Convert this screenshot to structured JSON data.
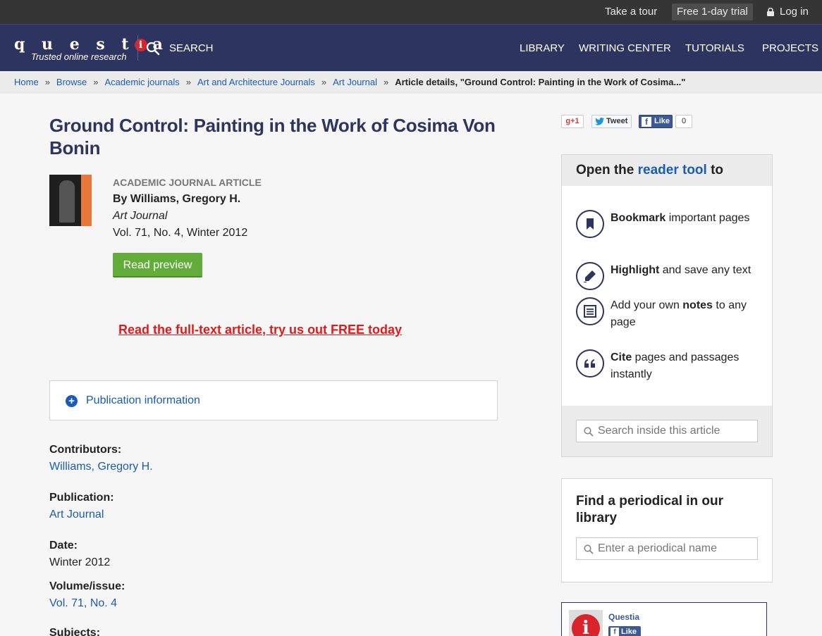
{
  "topbar": {
    "take_tour": "Take a tour",
    "free_trial": "Free 1-day trial",
    "login": "Log in"
  },
  "nav": {
    "logo_word": "questia",
    "logo_tagline": "Trusted online research",
    "search": "SEARCH",
    "links": [
      "LIBRARY",
      "WRITING CENTER",
      "TUTORIALS",
      "PROJECTS"
    ]
  },
  "breadcrumb": {
    "items": [
      "Home",
      "Browse",
      "Academic journals",
      "Art and Architecture Journals",
      "Art Journal"
    ],
    "separator": "»",
    "current": "Article details, \"Ground Control: Painting in the Work of Cosima...\""
  },
  "article": {
    "title": "Ground Control: Painting in the Work of Cosima Von Bonin",
    "type": "ACADEMIC JOURNAL ARTICLE",
    "author": "By Williams, Gregory H.",
    "journal": "Art Journal",
    "volume": "Vol. 71, No. 4, Winter 2012",
    "read_preview": "Read preview",
    "promo": "Read the full-text article, try us out FREE today",
    "pub_info_label": "Publication information",
    "plus": "+"
  },
  "details": [
    {
      "term": "Contributors:",
      "value": "Williams, Gregory H.",
      "link": true
    },
    {
      "term": "Publication:",
      "value": "Art Journal",
      "link": true
    },
    {
      "term": "Date:",
      "value": "Winter 2012",
      "link": false
    },
    {
      "term": "Volume/issue:",
      "value": "Vol. 71, No. 4",
      "link": true
    },
    {
      "term": "Subjects:",
      "value": "",
      "link": false
    }
  ],
  "social": {
    "gplus": "g+1",
    "tweet": "Tweet",
    "like": "Like",
    "like_count": "0"
  },
  "reader": {
    "head_prefix": "Open the",
    "head_highlight": "reader tool",
    "head_suffix": "to",
    "features": [
      {
        "icon": "bookmark-icon",
        "bold": "Bookmark",
        "before": "",
        "after": " important pages"
      },
      {
        "icon": "highlight-pen-icon",
        "bold": "Highlight",
        "before": "",
        "after": " and save any text"
      },
      {
        "icon": "notes-icon",
        "bold": "notes",
        "before": "Add your own ",
        "after": " to any page"
      },
      {
        "icon": "quote-icon",
        "bold": "Cite",
        "before": "",
        "after": " pages and passages instantly"
      }
    ],
    "search_placeholder": "Search inside this article"
  },
  "periodical": {
    "heading": "Find a periodical in our library",
    "placeholder": "Enter a periodical name"
  },
  "fb_widget": {
    "name": "Questia",
    "like": "Like",
    "logo_letter": "i"
  },
  "colors": {
    "nav_bg": "#2e3460",
    "link": "#1a5bb8",
    "promo": "#e01b1b",
    "preview_button": "#62ac3a"
  }
}
